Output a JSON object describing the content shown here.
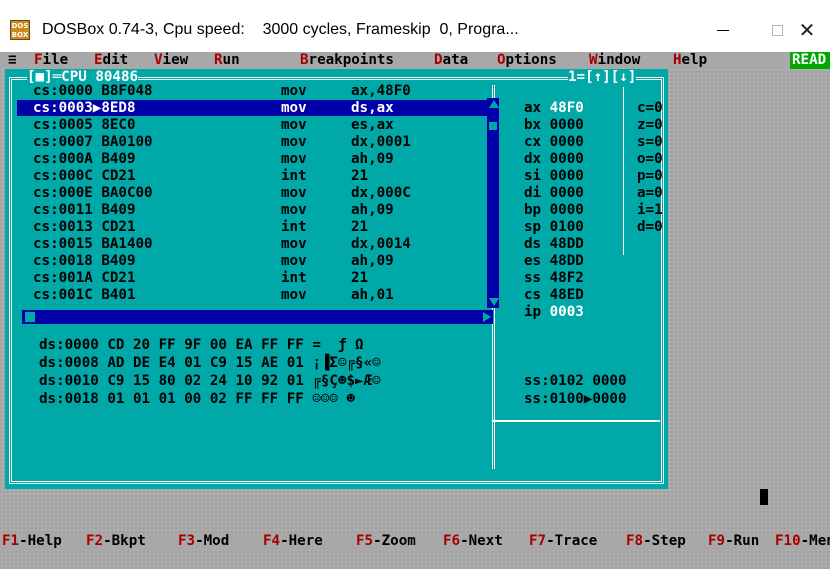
{
  "window": {
    "icon_text": "DOS BOX",
    "title": "DOSBox 0.74-3, Cpu speed:    3000 cycles, Frameskip  0, Progra...",
    "minimize_glyph": "—",
    "close_glyph": "✕"
  },
  "menu": {
    "system": "≡",
    "items": [
      {
        "hk": "F",
        "rest": "ile"
      },
      {
        "hk": "E",
        "rest": "dit"
      },
      {
        "hk": "V",
        "rest": "iew"
      },
      {
        "hk": "R",
        "rest": "un"
      },
      {
        "hk": "B",
        "rest": "reakpoints"
      },
      {
        "hk": "D",
        "rest": "ata"
      },
      {
        "hk": "O",
        "rest": "ptions"
      },
      {
        "hk": "W",
        "rest": "indow"
      },
      {
        "hk": "H",
        "rest": "elp"
      }
    ],
    "status": "READ"
  },
  "cpu_window": {
    "close_box": "[■]",
    "title": "CPU 80486",
    "right_label": "1=[↑][↓]",
    "code": [
      {
        "addr": "cs:0000 B8F048",
        "op": "mov",
        "args": "ax,48F0"
      },
      {
        "addr": "cs:0003▶8ED8",
        "op": "mov",
        "args": "ds,ax"
      },
      {
        "addr": "cs:0005 8EC0",
        "op": "mov",
        "args": "es,ax"
      },
      {
        "addr": "cs:0007 BA0100",
        "op": "mov",
        "args": "dx,0001"
      },
      {
        "addr": "cs:000A B409",
        "op": "mov",
        "args": "ah,09"
      },
      {
        "addr": "cs:000C CD21",
        "op": "int",
        "args": "21"
      },
      {
        "addr": "cs:000E BA0C00",
        "op": "mov",
        "args": "dx,000C"
      },
      {
        "addr": "cs:0011 B409",
        "op": "mov",
        "args": "ah,09"
      },
      {
        "addr": "cs:0013 CD21",
        "op": "int",
        "args": "21"
      },
      {
        "addr": "cs:0015 BA1400",
        "op": "mov",
        "args": "dx,0014"
      },
      {
        "addr": "cs:0018 B409",
        "op": "mov",
        "args": "ah,09"
      },
      {
        "addr": "cs:001A CD21",
        "op": "int",
        "args": "21"
      },
      {
        "addr": "cs:001C B401",
        "op": "mov",
        "args": "ah,01"
      }
    ],
    "selected_row": 1,
    "registers": [
      {
        "name": "ax",
        "value": "48F0",
        "changed": true
      },
      {
        "name": "bx",
        "value": "0000",
        "changed": false
      },
      {
        "name": "cx",
        "value": "0000",
        "changed": false
      },
      {
        "name": "dx",
        "value": "0000",
        "changed": false
      },
      {
        "name": "si",
        "value": "0000",
        "changed": false
      },
      {
        "name": "di",
        "value": "0000",
        "changed": false
      },
      {
        "name": "bp",
        "value": "0000",
        "changed": false
      },
      {
        "name": "sp",
        "value": "0100",
        "changed": false
      },
      {
        "name": "ds",
        "value": "48DD",
        "changed": false
      },
      {
        "name": "es",
        "value": "48DD",
        "changed": false
      },
      {
        "name": "ss",
        "value": "48F2",
        "changed": false
      },
      {
        "name": "cs",
        "value": "48ED",
        "changed": false
      },
      {
        "name": "ip",
        "value": "0003",
        "changed": true
      }
    ],
    "flags": [
      "c=0",
      "z=0",
      "s=0",
      "o=0",
      "p=0",
      "a=0",
      "i=1",
      "d=0"
    ],
    "dump": [
      "ds:0000 CD 20 FF 9F 00 EA FF FF =  ƒ Ω",
      "ds:0008 AD DE E4 01 C9 15 AE 01 ¡▐Σ☺╔§«☺",
      "ds:0010 C9 15 80 02 24 10 92 01 ╔§Ç☻$►Æ☺",
      "ds:0018 01 01 01 00 02 FF FF FF ☺☺☺ ☻"
    ],
    "stack": [
      "ss:0102 0000",
      "ss:0100▶0000"
    ]
  },
  "fkeys": [
    {
      "k": "F1",
      "label": "-Help"
    },
    {
      "k": "F2",
      "label": "-Bkpt"
    },
    {
      "k": "F3",
      "label": "-Mod"
    },
    {
      "k": "F4",
      "label": "-Here"
    },
    {
      "k": "F5",
      "label": "-Zoom"
    },
    {
      "k": "F6",
      "label": "-Next"
    },
    {
      "k": "F7",
      "label": "-Trace"
    },
    {
      "k": "F8",
      "label": "-Step"
    },
    {
      "k": "F9",
      "label": "-Run"
    },
    {
      "k": "F10",
      "label": "-Menu"
    }
  ],
  "colors": {
    "cyan": "#00a8a8",
    "blue": "#0000a8",
    "gray": "#a8a8a8",
    "hotkey_red": "#a80000",
    "ready_green": "#00a800"
  }
}
